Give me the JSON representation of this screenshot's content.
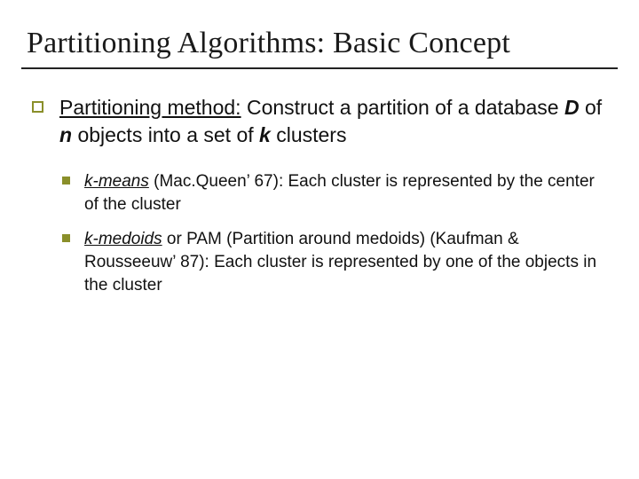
{
  "title": "Partitioning Algorithms: Basic Concept",
  "main": {
    "lead_u": "Partitioning method:",
    "t1": " Construct a partition of a database ",
    "D": "D",
    "t2": " of ",
    "n": "n",
    "t3": " objects into a set of ",
    "k": "k",
    "t4": " clusters"
  },
  "sub": {
    "a_term": "k-means",
    "a_rest": " (Mac.Queen’ 67): Each cluster is represented by the center of the cluster",
    "b_term": "k-medoids",
    "b_rest": " or PAM (Partition around medoids) (Kaufman & Rousseeuw’ 87): Each cluster is represented by one of the objects in the cluster"
  }
}
